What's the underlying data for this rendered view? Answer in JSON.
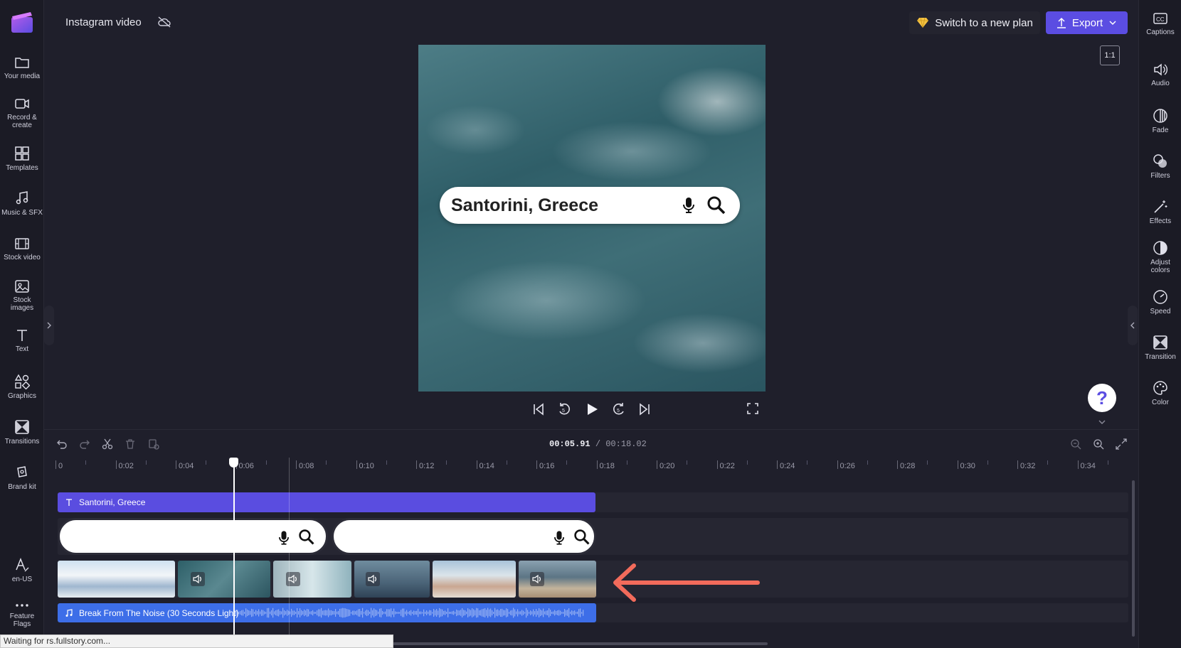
{
  "header": {
    "project_title": "Instagram video",
    "switch_plan_label": "Switch to a new plan",
    "export_label": "Export",
    "aspect_ratio": "1:1"
  },
  "left_nav": [
    {
      "label": "Your media",
      "icon": "folder-icon"
    },
    {
      "label": "Record & create",
      "icon": "camera-icon"
    },
    {
      "label": "Templates",
      "icon": "templates-icon"
    },
    {
      "label": "Music & SFX",
      "icon": "music-icon"
    },
    {
      "label": "Stock video",
      "icon": "film-icon"
    },
    {
      "label": "Stock images",
      "icon": "image-icon"
    },
    {
      "label": "Text",
      "icon": "text-icon"
    },
    {
      "label": "Graphics",
      "icon": "shapes-icon"
    },
    {
      "label": "Transitions",
      "icon": "transition-icon"
    },
    {
      "label": "Brand kit",
      "icon": "brand-icon"
    }
  ],
  "left_bottom": {
    "language": "en-US",
    "feature_flags": "Feature Flags"
  },
  "right_nav": [
    {
      "label": "Captions",
      "icon": "cc-icon"
    },
    {
      "label": "Audio",
      "icon": "speaker-icon"
    },
    {
      "label": "Fade",
      "icon": "fade-icon"
    },
    {
      "label": "Filters",
      "icon": "filters-icon"
    },
    {
      "label": "Effects",
      "icon": "wand-icon"
    },
    {
      "label": "Adjust colors",
      "icon": "contrast-icon"
    },
    {
      "label": "Speed",
      "icon": "speedometer-icon"
    },
    {
      "label": "Transition",
      "icon": "transition-icon"
    },
    {
      "label": "Color",
      "icon": "palette-icon"
    }
  ],
  "preview": {
    "search_text": "Santorini, Greece"
  },
  "help_label": "?",
  "timeline": {
    "current_time": "00:05.91",
    "total_time": "/ 00:18.02",
    "ruler_labels": [
      "0",
      "0:02",
      "0:04",
      "0:06",
      "0:08",
      "0:10",
      "0:12",
      "0:14",
      "0:16",
      "0:18",
      "0:20",
      "0:22",
      "0:24",
      "0:26",
      "0:28",
      "0:30",
      "0:32",
      "0:34"
    ],
    "text_clip_label": "Santorini, Greece",
    "audio_clip_label": "Break From The Noise (30 Seconds Light)"
  },
  "status_text": "Waiting for rs.fullstory.com...",
  "colors": {
    "accent": "#5b4de2",
    "audio": "#3d6ee8",
    "arrow": "#f26b5b"
  }
}
